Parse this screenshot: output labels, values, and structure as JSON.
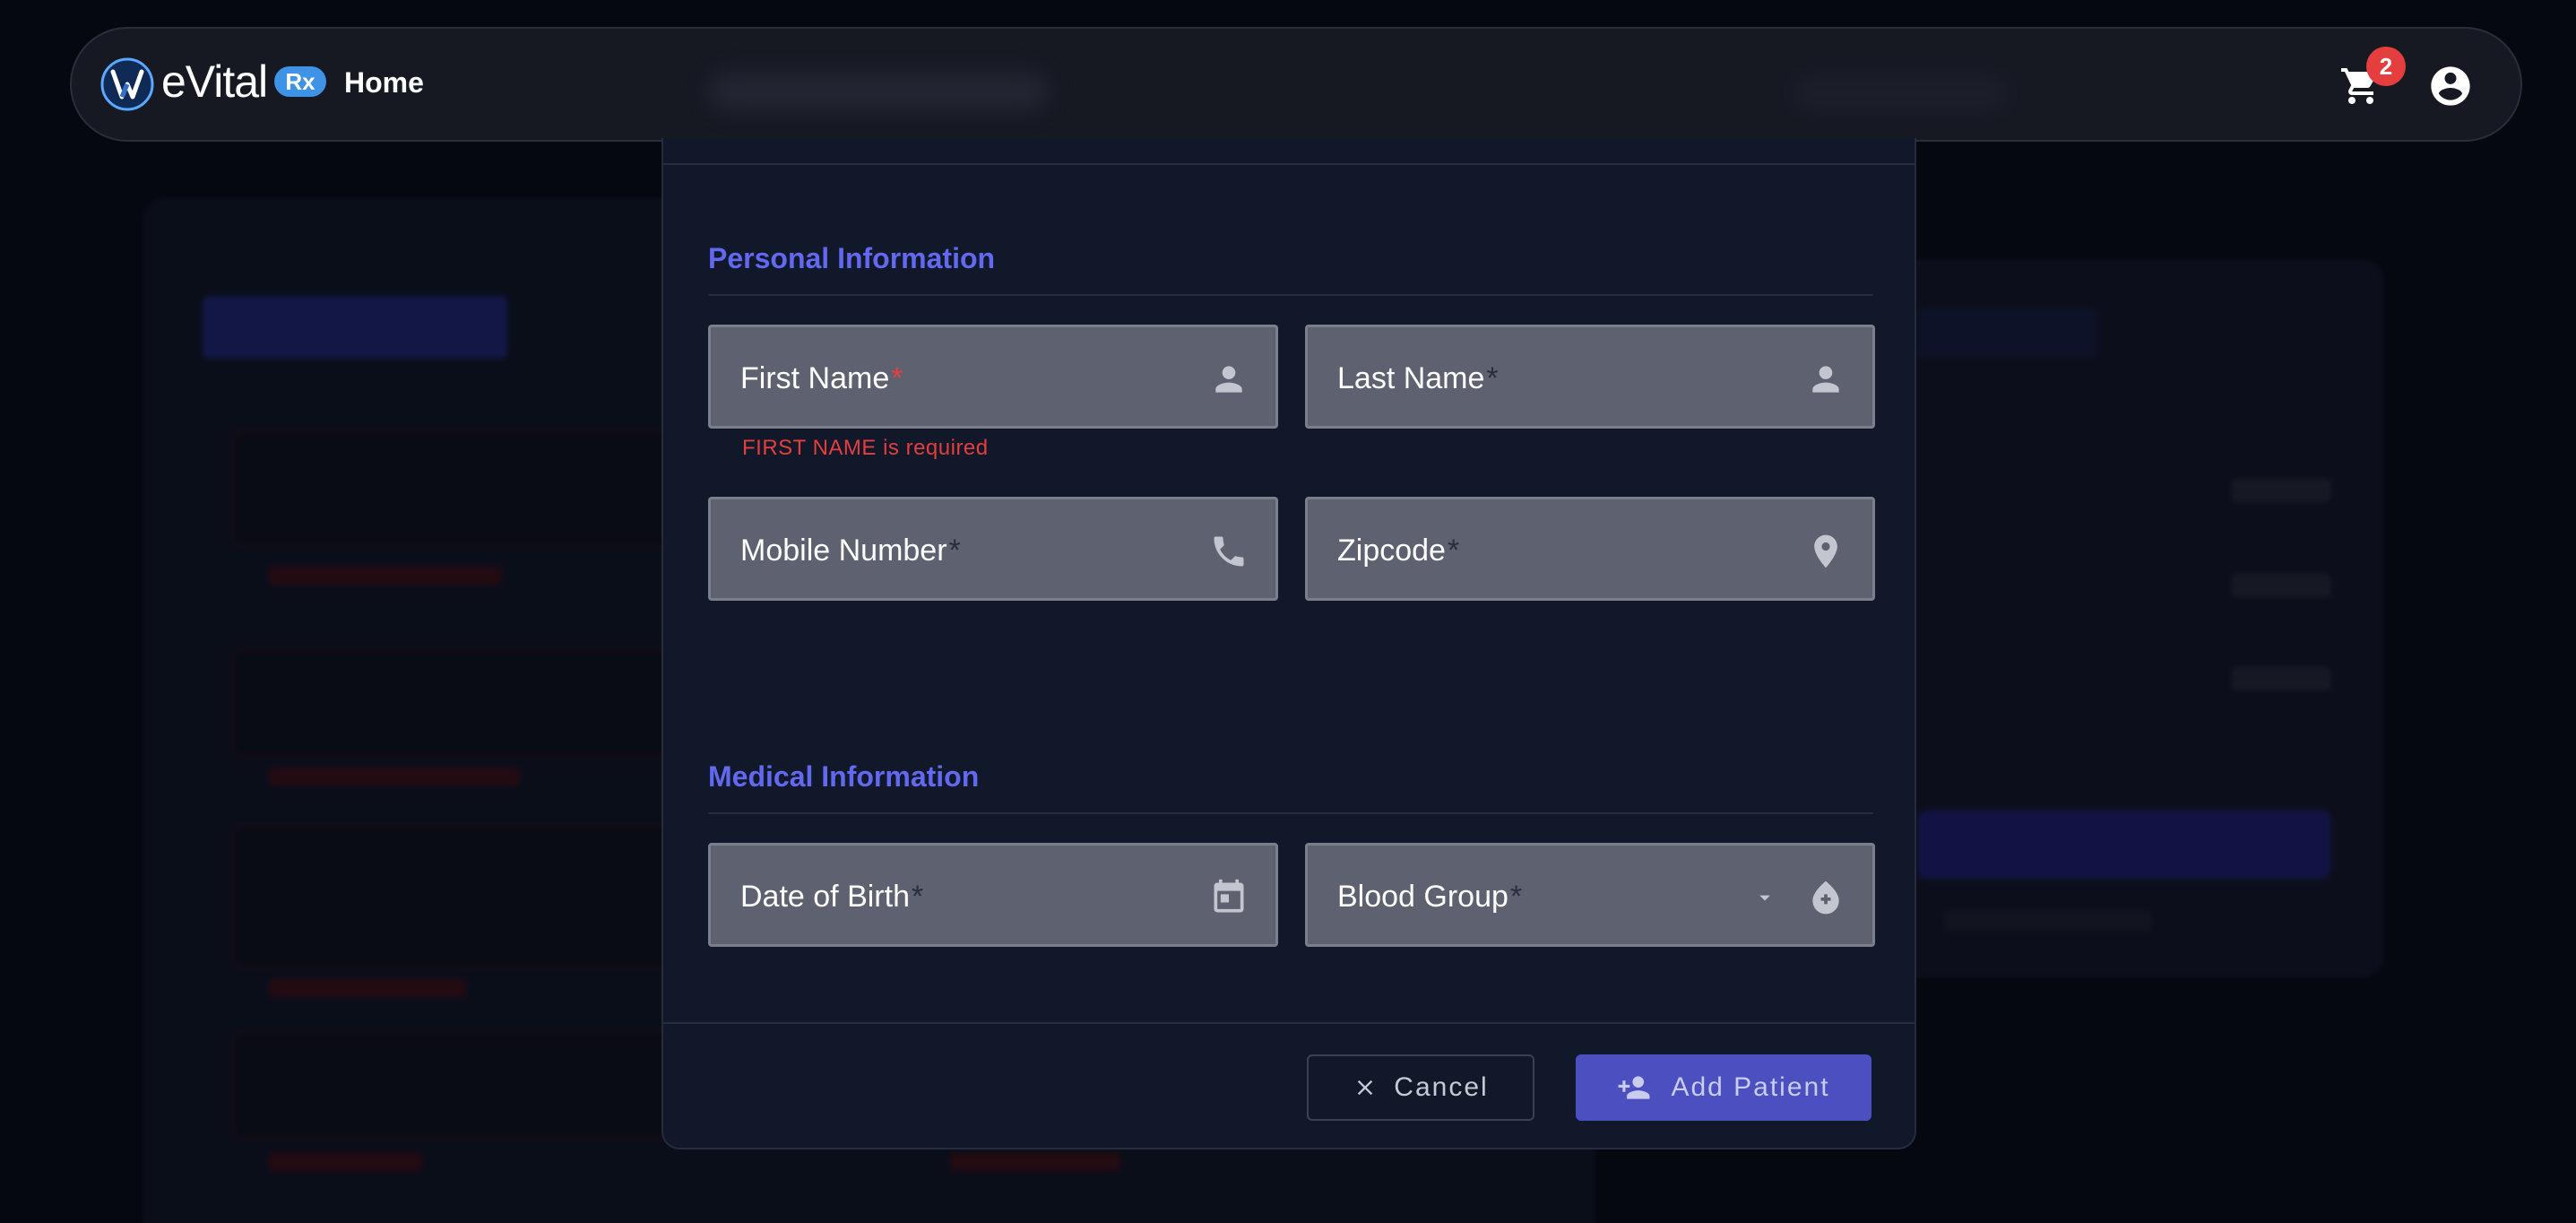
{
  "nav": {
    "brand": "eVital",
    "brand_badge": "Rx",
    "home_label": "Home",
    "cart_count": "2"
  },
  "modal": {
    "personal_section": "Personal Information",
    "medical_section": "Medical Information",
    "fields": {
      "first_name": {
        "label": "First Name",
        "required_mark": "*",
        "error": "FIRST NAME is required"
      },
      "last_name": {
        "label": "Last Name",
        "required_mark": "*"
      },
      "mobile": {
        "label": "Mobile Number",
        "required_mark": "*"
      },
      "zipcode": {
        "label": "Zipcode",
        "required_mark": "*"
      },
      "dob": {
        "label": "Date of Birth",
        "required_mark": "*"
      },
      "blood_group": {
        "label": "Blood Group",
        "required_mark": "*"
      }
    },
    "cancel_label": "Cancel",
    "add_patient_label": "Add Patient"
  },
  "colors": {
    "accent": "#6368f0",
    "error": "#e53e3e",
    "primary_button": "#4b4fbf",
    "badge": "#e53e3e",
    "rx_badge": "#3e93e6"
  },
  "icons": {
    "logo": "evital-logo-icon",
    "cart": "cart-icon",
    "account": "account-circle-icon",
    "person": "person-icon",
    "phone": "phone-icon",
    "location": "location-pin-icon",
    "calendar": "calendar-icon",
    "dropdown": "dropdown-caret-icon",
    "blood": "blood-drop-icon",
    "close": "close-icon",
    "add_person": "add-person-icon"
  }
}
